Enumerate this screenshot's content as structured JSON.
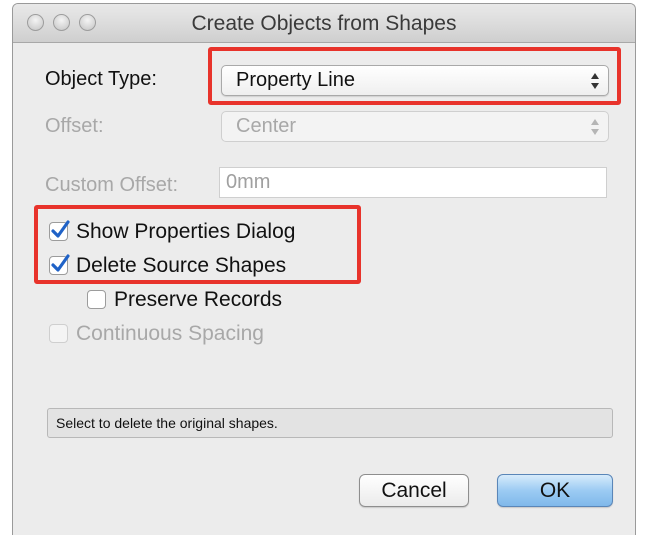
{
  "window": {
    "title": "Create Objects from Shapes"
  },
  "form": {
    "object_type": {
      "label": "Object Type:",
      "value": "Property Line"
    },
    "offset": {
      "label": "Offset:",
      "value": "Center"
    },
    "custom_offset": {
      "label": "Custom Offset:",
      "value": "0mm"
    }
  },
  "options": {
    "show_properties": {
      "label": "Show Properties Dialog",
      "checked": true
    },
    "delete_source": {
      "label": "Delete Source Shapes",
      "checked": true
    },
    "preserve_records": {
      "label": "Preserve Records",
      "checked": false
    },
    "continuous_spacing": {
      "label": "Continuous Spacing",
      "checked": false,
      "disabled": true
    }
  },
  "status": {
    "text": "Select to delete the original shapes."
  },
  "buttons": {
    "cancel": "Cancel",
    "ok": "OK"
  },
  "colors": {
    "highlight": "#e8332b",
    "default_button": "#9ccbf3",
    "checkmark": "#1f62c7"
  }
}
